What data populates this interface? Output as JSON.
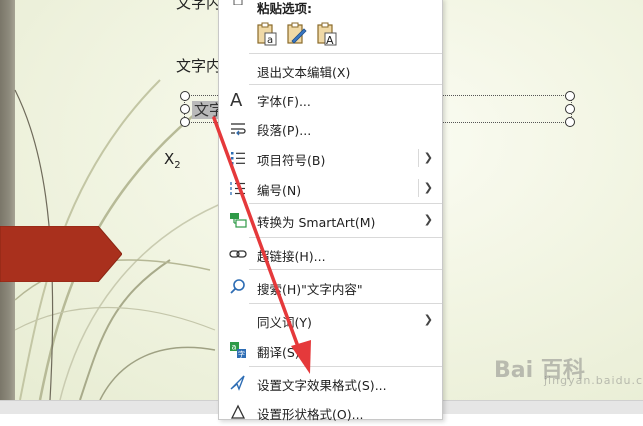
{
  "slide": {
    "text_top": "文字内",
    "text_mid": "文字内",
    "selected_text": "文字",
    "subscript_label": "X",
    "subscript_index": "2"
  },
  "context_menu": {
    "paste_header": "粘贴选项:",
    "paste_options": [
      "keep-source-formatting-icon",
      "use-destination-theme-icon",
      "keep-text-only-icon"
    ],
    "items": [
      {
        "label": "退出文本编辑(X)",
        "icon": "",
        "submenu": false
      },
      {
        "label": "字体(F)...",
        "icon": "font-icon",
        "submenu": false
      },
      {
        "label": "段落(P)...",
        "icon": "paragraph-icon",
        "submenu": false
      },
      {
        "label": "项目符号(B)",
        "icon": "bullets-icon",
        "submenu": true
      },
      {
        "label": "编号(N)",
        "icon": "numbering-icon",
        "submenu": true
      },
      {
        "label": "转换为 SmartArt(M)",
        "icon": "smartart-icon",
        "submenu": true
      },
      {
        "label": "超链接(H)...",
        "icon": "link-icon",
        "submenu": false
      },
      {
        "label": "搜索(H)\"文字内容\"",
        "icon": "search-icon",
        "submenu": false
      },
      {
        "label": "同义词(Y)",
        "icon": "",
        "submenu": true
      },
      {
        "label": "翻译(S)",
        "icon": "translate-icon",
        "submenu": false
      },
      {
        "label": "设置文字效果格式(S)...",
        "icon": "text-effects-icon",
        "submenu": false
      },
      {
        "label": "设置形状格式(O)...",
        "icon": "shape-format-icon",
        "submenu": false
      }
    ]
  },
  "watermark": {
    "brand": "Bai  百科",
    "sub": "jingyan.baidu.com"
  },
  "colors": {
    "accent_red": "#e5393b",
    "slide_arrow": "#a9301d",
    "menu_icon_blue": "#2e6db4",
    "smartart_green": "#2e9a47"
  }
}
